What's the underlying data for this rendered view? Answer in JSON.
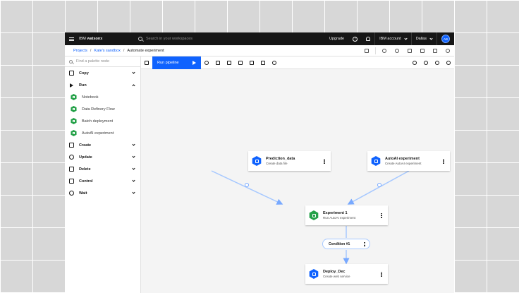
{
  "header": {
    "brand_prefix": "IBM",
    "brand_name": "watsonx",
    "search_placeholder": "Search in your workspaces",
    "upgrade_label": "Upgrade",
    "account_label": "IBM account",
    "region_label": "Dallas",
    "avatar_initials": "AB"
  },
  "breadcrumb": {
    "items": [
      "Projects",
      "Kate's sandbox"
    ],
    "current": "Automate experiment"
  },
  "palette": {
    "search_placeholder": "Find a palette node",
    "categories": [
      {
        "label": "Copy",
        "icon": "copy-icon",
        "expanded": false
      },
      {
        "label": "Run",
        "icon": "run-icon",
        "expanded": true
      },
      {
        "label": "Create",
        "icon": "create-icon",
        "expanded": false
      },
      {
        "label": "Update",
        "icon": "update-icon",
        "expanded": false
      },
      {
        "label": "Delete",
        "icon": "delete-icon",
        "expanded": false
      },
      {
        "label": "Control",
        "icon": "control-icon",
        "expanded": false
      },
      {
        "label": "Wait",
        "icon": "wait-icon",
        "expanded": false
      }
    ],
    "run_items": [
      "Notebook",
      "Data Refinery Flow",
      "Batch deployment",
      "AutoAI experiment"
    ]
  },
  "toolbar": {
    "run_label": "Run pipeline"
  },
  "canvas": {
    "nodes": [
      {
        "id": "prediction",
        "title": "Prediction_data",
        "subtitle": "Create data file",
        "color": "#0f62fe"
      },
      {
        "id": "autoai",
        "title": "AutoAI experiment",
        "subtitle": "Create AutoAI experiment",
        "color": "#0f62fe"
      },
      {
        "id": "experiment",
        "title": "Experiment 1",
        "subtitle": "Run AutoAI experiment",
        "color": "#24a148"
      },
      {
        "id": "deploy",
        "title": "Deploy_Dec",
        "subtitle": "Create web service",
        "color": "#0f62fe"
      }
    ],
    "condition_label": "Condition #1"
  },
  "colors": {
    "accent": "#0f62fe",
    "success": "#24a148",
    "link_line": "#a6c8ff"
  }
}
